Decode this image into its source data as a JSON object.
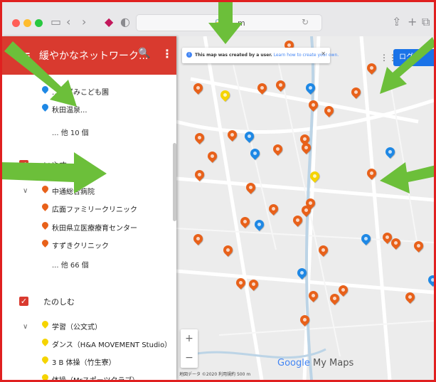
{
  "browser": {
    "address": "g...m",
    "colors": {
      "close": "#ff5f57",
      "min": "#febc2e",
      "max": "#28c840"
    }
  },
  "sidebar": {
    "header_title": "緩やかなネットワーク...",
    "sections": [
      {
        "items": [
          {
            "label": "…いずみこども園",
            "color": "#1e88e5"
          },
          {
            "label": "秋田温泉...",
            "color": "#1e88e5"
          }
        ],
        "more": "... 他 10 個"
      },
      {
        "name": "いやす",
        "items": [
          {
            "label": "中通総合病院",
            "color": "#e8611a"
          },
          {
            "label": "広面ファミリークリニック",
            "color": "#e8611a"
          },
          {
            "label": "秋田県立医療療育センター",
            "color": "#e8611a"
          },
          {
            "label": "すずきクリニック",
            "color": "#e8611a"
          }
        ],
        "more": "... 他 66 個"
      },
      {
        "name": "たのしむ",
        "items": [
          {
            "label": "学習（公文式）",
            "color": "#f5d400"
          },
          {
            "label": "ダンス（H&A MOVEMENT Studio）",
            "color": "#f5d400"
          },
          {
            "label": "3 B 体操（竹生寮）",
            "color": "#f5d400"
          },
          {
            "label": "体操（Mrスポーツクラブ）",
            "color": "#f5d400"
          }
        ]
      }
    ]
  },
  "map": {
    "banner_bold": "This map was created by a user.",
    "banner_link": "Learn how to create your own.",
    "login": "ログイ",
    "brand_google": "Google",
    "brand_rest": " My Maps",
    "attribution": "地図データ ©2020  利用規約  500 m",
    "pin_colors": {
      "orange": "#e8611a",
      "blue": "#1e88e5",
      "yellow": "#f5d400"
    },
    "zoom_in": "+",
    "zoom_out": "−"
  }
}
